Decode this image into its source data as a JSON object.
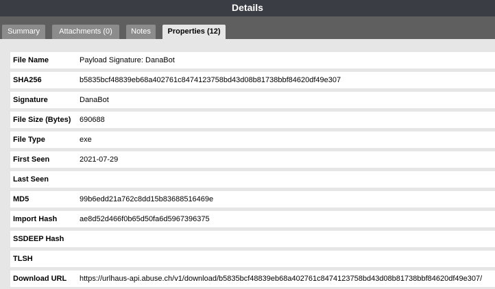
{
  "window": {
    "title": "Details"
  },
  "tabs": [
    {
      "label": "Summary",
      "active": false
    },
    {
      "label": "Attachments (0)",
      "active": false
    },
    {
      "label": "Notes",
      "active": false
    },
    {
      "label": "Properties (12)",
      "active": true
    }
  ],
  "properties": [
    {
      "key": "File Name",
      "value": "Payload Signature: DanaBot"
    },
    {
      "key": "SHA256",
      "value": "b5835bcf48839eb68a402761c8474123758bd43d08b81738bbf84620df49e307"
    },
    {
      "key": "Signature",
      "value": "DanaBot"
    },
    {
      "key": "File Size (Bytes)",
      "value": "690688"
    },
    {
      "key": "File Type",
      "value": "exe"
    },
    {
      "key": "First Seen",
      "value": "2021-07-29"
    },
    {
      "key": "Last Seen",
      "value": ""
    },
    {
      "key": "MD5",
      "value": "99b6edd21a762c8dd15b83688516469e"
    },
    {
      "key": "Import Hash",
      "value": "ae8d52d466f0b65d50fa6d5967396375"
    },
    {
      "key": "SSDEEP Hash",
      "value": ""
    },
    {
      "key": "TLSH",
      "value": ""
    },
    {
      "key": "Download URL",
      "value": "https://urlhaus-api.abuse.ch/v1/download/b5835bcf48839eb68a402761c8474123758bd43d08b81738bbf84620df49e307/"
    }
  ],
  "colors": {
    "titlebar": "#3a3d44",
    "tabstrip": "#5f5f5f",
    "tab_inactive": "#8c8c8c",
    "tab_active": "#e6e6e6",
    "panel": "#e6e6e6",
    "cell": "#ffffff"
  }
}
